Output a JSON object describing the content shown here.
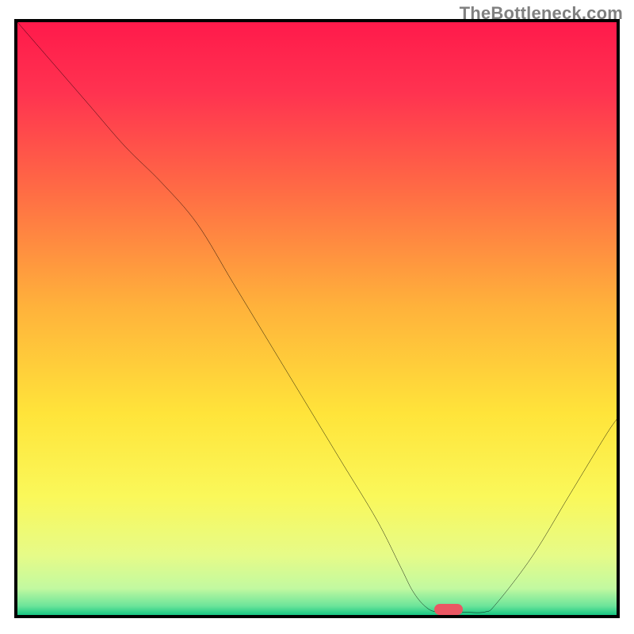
{
  "watermark": {
    "text": "TheBottleneck.com"
  },
  "chart_data": {
    "type": "line",
    "title": "",
    "xlabel": "",
    "ylabel": "",
    "xlim": [
      0,
      100
    ],
    "ylim": [
      0,
      100
    ],
    "grid": false,
    "series": [
      {
        "name": "bottleneck-curve",
        "color": "#000000",
        "x": [
          0,
          6,
          12,
          18,
          24,
          30,
          36,
          42,
          48,
          54,
          60,
          64,
          66,
          68,
          70,
          74,
          78,
          80,
          86,
          92,
          98,
          100
        ],
        "y": [
          100,
          93,
          86,
          79,
          73,
          66,
          56,
          46,
          36,
          26,
          16,
          8,
          4,
          1.5,
          0.5,
          0.5,
          0.5,
          2,
          10,
          20,
          30,
          33
        ]
      }
    ],
    "background_gradient": {
      "type": "vertical",
      "stops": [
        {
          "pct": 0.0,
          "color": "#ff1a4b"
        },
        {
          "pct": 0.12,
          "color": "#ff3350"
        },
        {
          "pct": 0.28,
          "color": "#ff6a45"
        },
        {
          "pct": 0.48,
          "color": "#ffb23b"
        },
        {
          "pct": 0.66,
          "color": "#ffe43a"
        },
        {
          "pct": 0.8,
          "color": "#faf85a"
        },
        {
          "pct": 0.9,
          "color": "#e6fb88"
        },
        {
          "pct": 0.955,
          "color": "#c2f9a0"
        },
        {
          "pct": 0.985,
          "color": "#6be49a"
        },
        {
          "pct": 1.0,
          "color": "#17c683"
        }
      ]
    },
    "marker": {
      "x": 72,
      "y": 0.9,
      "color": "#ea5763",
      "shape": "pill"
    }
  }
}
